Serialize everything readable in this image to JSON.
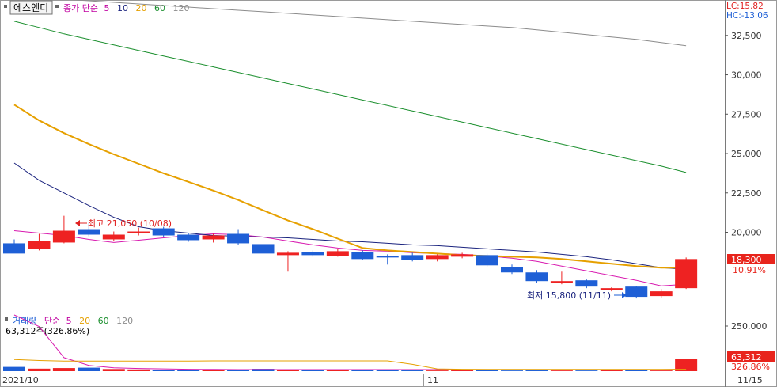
{
  "header": {
    "stock_name": "에스앤디",
    "price_legend": {
      "label": "종가 단순",
      "periods": [
        "5",
        "10",
        "20",
        "60",
        "120"
      ]
    },
    "lc_label": "LC:15.82",
    "hc_label": "HC:-13.06"
  },
  "colors": {
    "up": "#ee2222",
    "down": "#1e5fd6",
    "ma5": "#d81bb0",
    "ma10": "#1a237e",
    "ma20": "#e6a000",
    "ma60": "#1b8f2e",
    "ma120": "#8c8c8c",
    "tag_bg": "#e8241c"
  },
  "price_axis": {
    "ticks": [
      "32,500",
      "30,000",
      "27,500",
      "25,000",
      "22,500",
      "20,000"
    ]
  },
  "annotations": {
    "high": "최고 21,050 (10/08)",
    "low": "최저 15,800 (11/11)"
  },
  "tags": {
    "last_price": "18,300",
    "last_change": "10.91%",
    "last_volume": "63,312",
    "last_volume_ratio": "326.86%"
  },
  "volume": {
    "legend_label": "거래량",
    "legend_ma_label": "단순",
    "legend_periods": [
      "5",
      "20",
      "60",
      "120"
    ],
    "info": "63,312주(326.86%)",
    "axis_ticks": [
      "250,000"
    ]
  },
  "date_axis": {
    "labels": [
      "2021/10",
      "11",
      "11/15"
    ]
  },
  "chart_data": [
    {
      "type": "candlestick",
      "title": "에스앤디",
      "ylim": [
        15000,
        34500
      ],
      "yticks": [
        20000,
        22500,
        25000,
        27500,
        30000,
        32500
      ],
      "grid": false,
      "candles": [
        {
          "o": 19300,
          "h": 19550,
          "l": 18750,
          "c": 18650,
          "v": 22000
        },
        {
          "o": 18950,
          "h": 19900,
          "l": 18850,
          "c": 19450,
          "v": 13000
        },
        {
          "o": 19350,
          "h": 21050,
          "l": 19300,
          "c": 20100,
          "v": 16000
        },
        {
          "o": 20200,
          "h": 20600,
          "l": 19750,
          "c": 19850,
          "v": 18000
        },
        {
          "o": 19550,
          "h": 20050,
          "l": 19450,
          "c": 19850,
          "v": 11000
        },
        {
          "o": 20000,
          "h": 20300,
          "l": 19800,
          "c": 20050,
          "v": 9000
        },
        {
          "o": 20250,
          "h": 20350,
          "l": 19700,
          "c": 19800,
          "v": 6000
        },
        {
          "o": 19850,
          "h": 19950,
          "l": 19400,
          "c": 19500,
          "v": 6000
        },
        {
          "o": 19550,
          "h": 19900,
          "l": 19350,
          "c": 19800,
          "v": 8000
        },
        {
          "o": 19900,
          "h": 20200,
          "l": 19200,
          "c": 19300,
          "v": 10000
        },
        {
          "o": 19250,
          "h": 19300,
          "l": 18500,
          "c": 18650,
          "v": 12000
        },
        {
          "o": 18550,
          "h": 18800,
          "l": 17500,
          "c": 18700,
          "v": 8000
        },
        {
          "o": 18750,
          "h": 18850,
          "l": 18450,
          "c": 18550,
          "v": 5000
        },
        {
          "o": 18500,
          "h": 18950,
          "l": 18450,
          "c": 18800,
          "v": 6000
        },
        {
          "o": 18750,
          "h": 18850,
          "l": 18250,
          "c": 18300,
          "v": 5000
        },
        {
          "o": 18500,
          "h": 18600,
          "l": 17950,
          "c": 18450,
          "v": 4500
        },
        {
          "o": 18550,
          "h": 18700,
          "l": 18150,
          "c": 18250,
          "v": 4000
        },
        {
          "o": 18300,
          "h": 18600,
          "l": 18150,
          "c": 18550,
          "v": 3500
        },
        {
          "o": 18450,
          "h": 18700,
          "l": 18350,
          "c": 18600,
          "v": 4000
        },
        {
          "o": 18550,
          "h": 18650,
          "l": 17800,
          "c": 17900,
          "v": 4500
        },
        {
          "o": 17800,
          "h": 17950,
          "l": 17350,
          "c": 17450,
          "v": 3500
        },
        {
          "o": 17450,
          "h": 17600,
          "l": 16800,
          "c": 16900,
          "v": 4000
        },
        {
          "o": 16800,
          "h": 17500,
          "l": 16700,
          "c": 16900,
          "v": 3500
        },
        {
          "o": 16950,
          "h": 17000,
          "l": 16450,
          "c": 16550,
          "v": 3500
        },
        {
          "o": 16350,
          "h": 16500,
          "l": 16250,
          "c": 16450,
          "v": 4000
        },
        {
          "o": 16550,
          "h": 16600,
          "l": 15800,
          "c": 15900,
          "v": 7000
        },
        {
          "o": 15950,
          "h": 16400,
          "l": 15850,
          "c": 16250,
          "v": 3500
        },
        {
          "o": 16450,
          "h": 18400,
          "l": 16400,
          "c": 18300,
          "v": 63312
        }
      ],
      "series": [
        {
          "name": "5",
          "values": [
            20100,
            19950,
            19800,
            19550,
            19350,
            19500,
            19650,
            19800,
            19900,
            19850,
            19700,
            19450,
            19200,
            19000,
            18850,
            18800,
            18700,
            18650,
            18600,
            18500,
            18350,
            18150,
            17850,
            17550,
            17250,
            16950,
            16600,
            16700
          ]
        },
        {
          "name": "10",
          "values": [
            24400,
            23300,
            22500,
            21700,
            20950,
            20350,
            20100,
            19950,
            19800,
            19750,
            19700,
            19650,
            19550,
            19450,
            19400,
            19300,
            19200,
            19150,
            19050,
            18950,
            18850,
            18750,
            18600,
            18450,
            18250,
            18000,
            17750,
            17650
          ]
        },
        {
          "name": "20",
          "values": [
            28100,
            27100,
            26300,
            25600,
            24950,
            24350,
            23750,
            23200,
            22650,
            22050,
            21400,
            20750,
            20200,
            19600,
            19000,
            18850,
            18750,
            18650,
            18550,
            18500,
            18450,
            18400,
            18300,
            18150,
            18000,
            17850,
            17750,
            17750
          ]
        },
        {
          "name": "60",
          "values": [
            33400,
            33000,
            32600,
            32250,
            31900,
            31550,
            31200,
            30850,
            30500,
            30150,
            29800,
            29450,
            29100,
            28750,
            28400,
            28050,
            27700,
            27350,
            27000,
            26650,
            26300,
            25950,
            25600,
            25250,
            24900,
            24550,
            24200,
            23800
          ]
        },
        {
          "name": "120",
          "values": [
            35000,
            34900,
            34800,
            34700,
            34600,
            34500,
            34400,
            34300,
            34200,
            34100,
            34000,
            33900,
            33800,
            33700,
            33600,
            33500,
            33400,
            33300,
            33200,
            33100,
            33000,
            32850,
            32700,
            32550,
            32400,
            32250,
            32050,
            31850
          ]
        }
      ]
    },
    {
      "type": "bar",
      "title": "거래량",
      "yticks": [
        250000
      ],
      "ylim": [
        0,
        290000
      ],
      "ma": [
        {
          "name": "5",
          "values": [
            290000,
            230000,
            70000,
            30000,
            17000,
            14000,
            12000,
            10000,
            9000,
            8000,
            8000,
            8000,
            8000,
            8000,
            8000,
            8000,
            8000,
            8000,
            8000,
            8000,
            8000,
            8000,
            8000,
            8000,
            8000,
            8000,
            8000,
            9000
          ]
        },
        {
          "name": "20",
          "values": [
            60000,
            55000,
            52000,
            52000,
            52000,
            52000,
            52000,
            52000,
            53000,
            53000,
            53000,
            53000,
            53000,
            53000,
            53000,
            53000,
            35000,
            12000,
            10000,
            9000,
            9000,
            9000,
            9000,
            9000,
            9000,
            9000,
            9000,
            10000
          ]
        }
      ]
    }
  ]
}
